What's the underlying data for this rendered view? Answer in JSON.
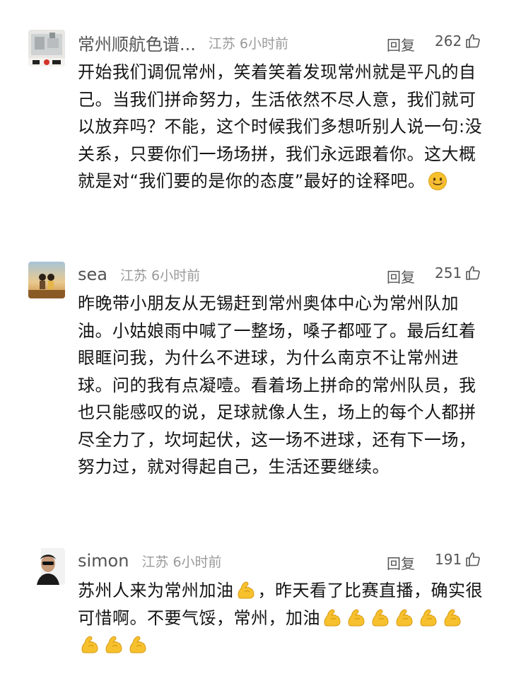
{
  "comments": [
    {
      "username": "常州顺航色谱...",
      "location": "江苏",
      "time": "6小时前",
      "reply_label": "回复",
      "likes": "262",
      "text": "开始我们调侃常州，笑着笑着发现常州就是平凡的自己。当我们拼命努力，生活依然不尽人意，我们就可以放弃吗？不能，这个时候我们多想听别人说一句:没关系，只要你们一场场拼，我们永远跟着你。这大概就是对“我们要的是你的态度”最好的诠释吧。",
      "emoji": "smiling-face-icon"
    },
    {
      "username": "sea",
      "location": "江苏",
      "time": "6小时前",
      "reply_label": "回复",
      "likes": "251",
      "text": "昨晚带小朋友从无锡赶到常州奥体中心为常州队加油。小姑娘雨中喊了一整场，嗓子都哑了。最后红着眼眶问我，为什么不进球，为什么南京不让常州进球。问的我有点凝噎。看着场上拼命的常州队员，我也只能感叹的说，足球就像人生，场上的每个人都拼尽全力了，坎坷起伏，这一场不进球，还有下一场，努力过，就对得起自己，生活还要继续。"
    },
    {
      "username": "simon",
      "location": "江苏",
      "time": "6小时前",
      "reply_label": "回复",
      "likes": "191",
      "text_part1": "苏州人来为常州加油",
      "text_part2": "，昨天看了比赛直播，确实很可惜啊。不要气馁，常州，加油",
      "emoji": "flexed-biceps-icon"
    }
  ],
  "colors": {
    "meta_gray": "#9a9a9a",
    "name_gray": "#545454",
    "emoji_yellow": "#f6c12d"
  }
}
